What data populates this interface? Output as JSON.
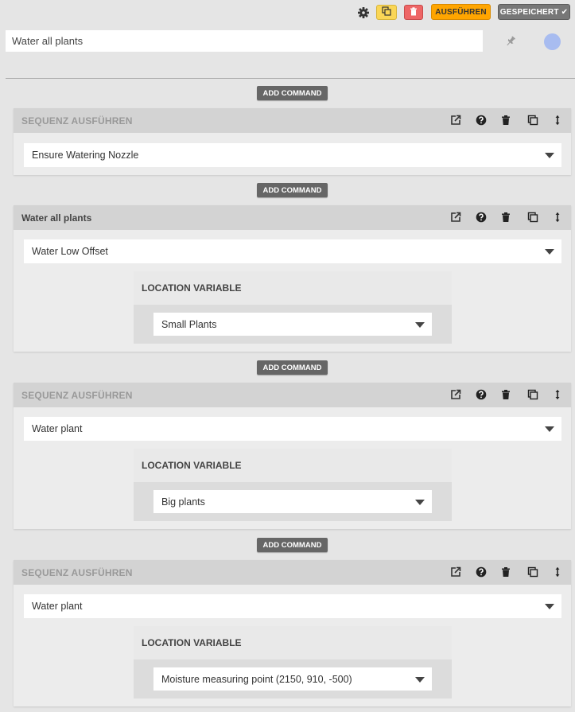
{
  "toolbar": {
    "settings_icon": "gear-icon",
    "copy_icon": "copy-icon",
    "delete_icon": "trash-icon",
    "run_label": "AUSFÜHREN",
    "saved_label": "GESPEICHERT ✔"
  },
  "sequence": {
    "name": "Water all plants",
    "pin_icon": "pin-icon",
    "color": "#a8bcf0"
  },
  "add_command_label": "ADD COMMAND",
  "steps": [
    {
      "title": "SEQUENZ AUSFÜHREN",
      "selected": "Ensure Watering Nozzle"
    },
    {
      "title": "Water all plants",
      "selected": "Water Low Offset",
      "variable": {
        "label": "LOCATION VARIABLE",
        "value": "Small Plants"
      }
    },
    {
      "title": "SEQUENZ AUSFÜHREN",
      "selected": "Water plant",
      "variable": {
        "label": "LOCATION VARIABLE",
        "value": "Big plants"
      }
    },
    {
      "title": "SEQUENZ AUSFÜHREN",
      "selected": "Water plant",
      "variable": {
        "label": "LOCATION VARIABLE",
        "value": "Moisture measuring point (2150, 910, -500)"
      }
    }
  ],
  "colors": {
    "run_button": "#ffa500",
    "saved_button": "#777777",
    "copy_button": "#fad656",
    "delete_button": "#ee6666",
    "add_command_button": "#666666",
    "step_header": "#d3d3d3"
  }
}
